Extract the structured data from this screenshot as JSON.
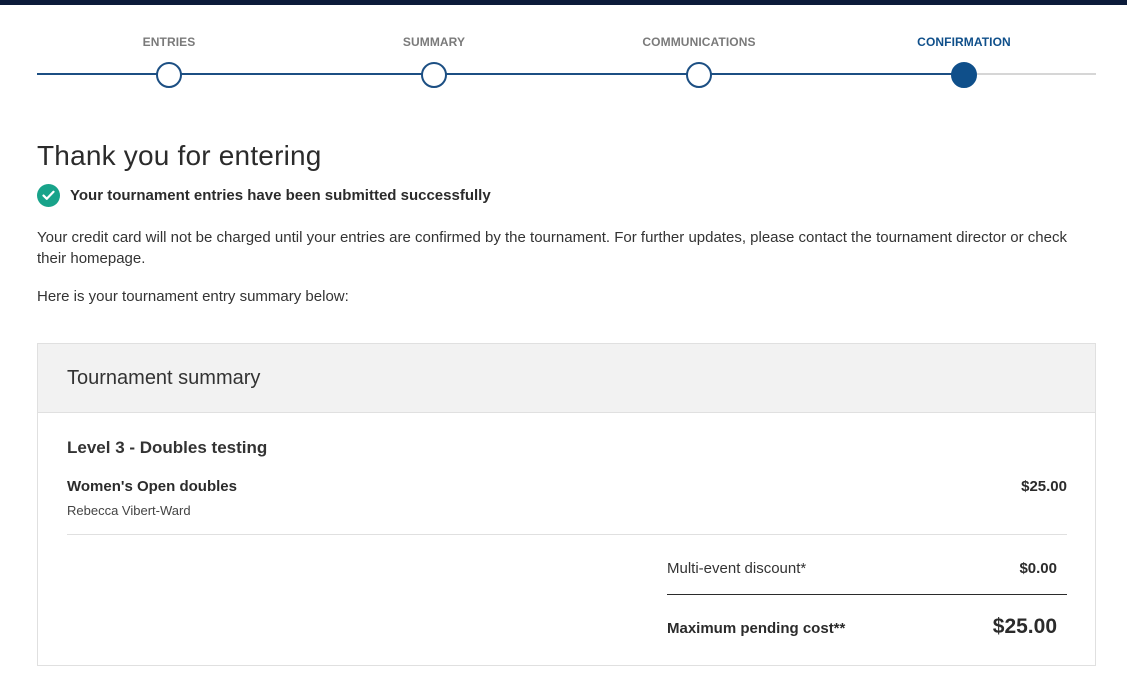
{
  "stepper": {
    "steps": [
      {
        "label": "ENTRIES"
      },
      {
        "label": "SUMMARY"
      },
      {
        "label": "COMMUNICATIONS"
      },
      {
        "label": "CONFIRMATION"
      }
    ],
    "active": "CONFIRMATION"
  },
  "page": {
    "title": "Thank you for entering",
    "success_message": "Your tournament entries have been submitted successfully",
    "info_text": "Your credit card will not be charged until your entries are confirmed by the tournament. For further updates, please contact the tournament director or check their homepage.",
    "summary_intro": "Here is your tournament entry summary below:"
  },
  "summary": {
    "heading": "Tournament summary",
    "tournament_name": "Level 3 - Doubles testing",
    "event": {
      "name": "Women's Open doubles",
      "player": "Rebecca Vibert-Ward",
      "price": "$25.00"
    },
    "discount_label": "Multi-event discount*",
    "discount_value": "$0.00",
    "max_cost_label": "Maximum pending cost**",
    "max_cost_value": "$25.00"
  },
  "colors": {
    "accent": "#0f4f8a",
    "success": "#18a38a",
    "topbar": "#0c1b3a"
  }
}
